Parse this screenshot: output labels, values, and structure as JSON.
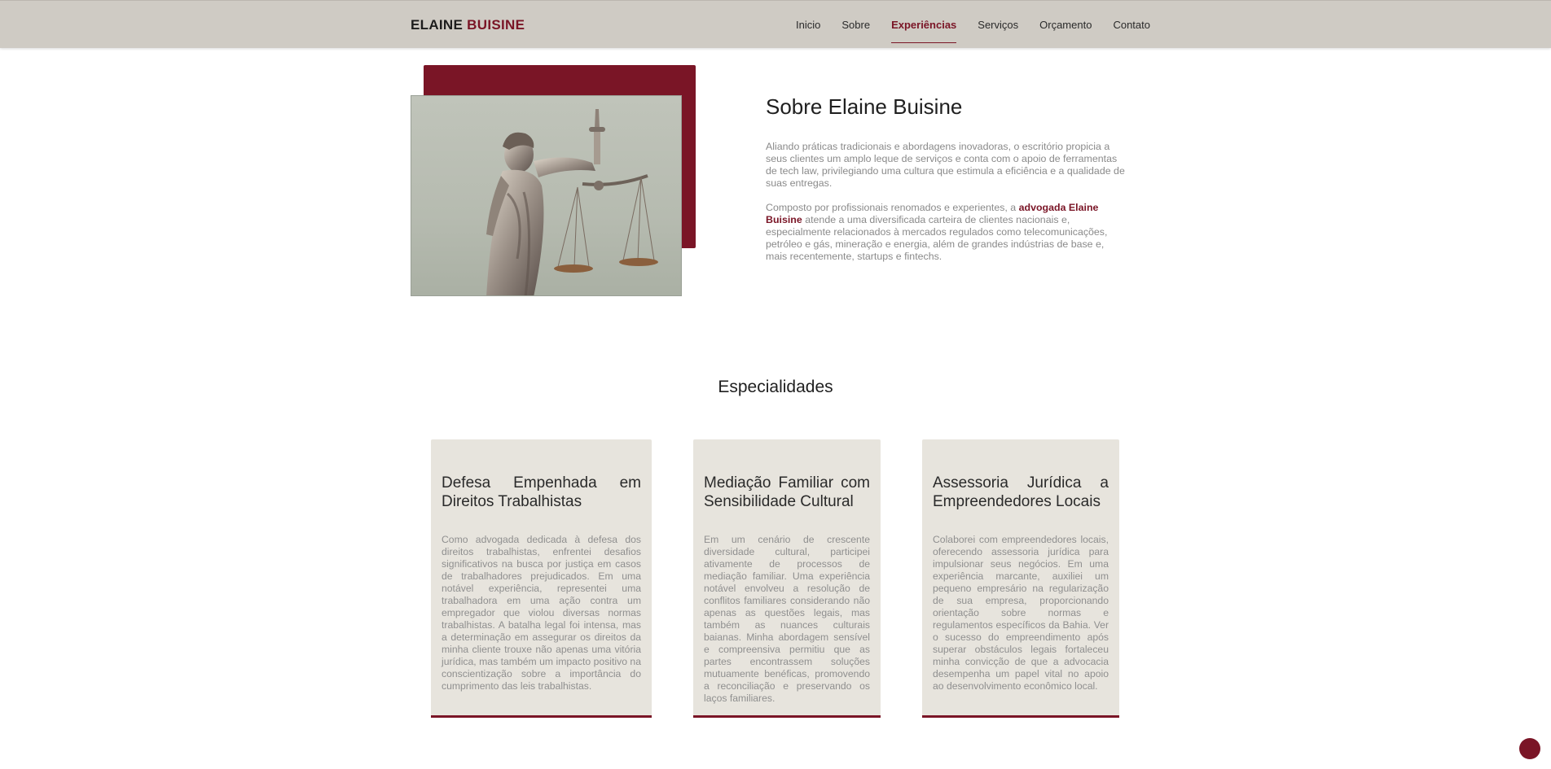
{
  "header": {
    "brand_first": "ELAINE",
    "brand_second": "BUISINE",
    "nav": [
      {
        "label": "Inicio"
      },
      {
        "label": "Sobre"
      },
      {
        "label": "Experiências"
      },
      {
        "label": "Serviços"
      },
      {
        "label": "Orçamento"
      },
      {
        "label": "Contato"
      }
    ],
    "active_index": 2
  },
  "about": {
    "title": "Sobre Elaine Buisine",
    "p1": "Aliando práticas tradicionais e abordagens inovadoras, o escritório propicia a seus clientes um amplo leque de serviços e conta com o apoio de ferramentas de tech law, privilegiando uma cultura que estimula a eficiência e a qualidade de suas entregas.",
    "p2_before": "Composto por profissionais renomados e experientes, a ",
    "p2_bold": "advogada Elaine Buisine",
    "p2_after": " atende a uma diversificada carteira de clientes nacionais e, especialmente relacionados à mercados regulados como telecomunicações, petróleo e gás, mineração e energia, além de grandes indústrias de base e, mais recentemente, startups e fintechs.",
    "image_icon": "lady-justice-statue-icon"
  },
  "specialties": {
    "title": "Especialidades",
    "cards": [
      {
        "title": "Defesa Empenhada em Direitos Trabalhistas",
        "text": "Como advogada dedicada à defesa dos direitos trabalhistas, enfrentei desafios significativos na busca por justiça em casos de trabalhadores prejudicados. Em uma notável experiência, representei uma trabalhadora em uma ação contra um empregador que violou diversas normas trabalhistas. A batalha legal foi intensa, mas a determinação em assegurar os direitos da minha cliente trouxe não apenas uma vitória jurídica, mas também um impacto positivo na conscientização sobre a importância do cumprimento das leis trabalhistas."
      },
      {
        "title": "Mediação Familiar com Sensibilidade Cultural",
        "text": "Em um cenário de crescente diversidade cultural, participei ativamente de processos de mediação familiar. Uma experiência notável envolveu a resolução de conflitos familiares considerando não apenas as questões legais, mas também as nuances culturais baianas. Minha abordagem sensível e compreensiva permitiu que as partes encontrassem soluções mutuamente benéficas, promovendo a reconciliação e preservando os laços familiares."
      },
      {
        "title": "Assessoria Jurídica a Empreendedores Locais",
        "text": "Colaborei com empreendedores locais, oferecendo assessoria jurídica para impulsionar seus negócios. Em uma experiência marcante, auxiliei um pequeno empresário na regularização de sua empresa, proporcionando orientação sobre normas e regulamentos específicos da Bahia. Ver o sucesso do empreendimento após superar obstáculos legais fortaleceu minha convicção de que a advocacia desempenha um papel vital no apoio ao desenvolvimento econômico local."
      }
    ]
  },
  "colors": {
    "accent": "#7a1526",
    "header_bg": "#cfcbc4",
    "card_bg": "#e7e4dd"
  }
}
